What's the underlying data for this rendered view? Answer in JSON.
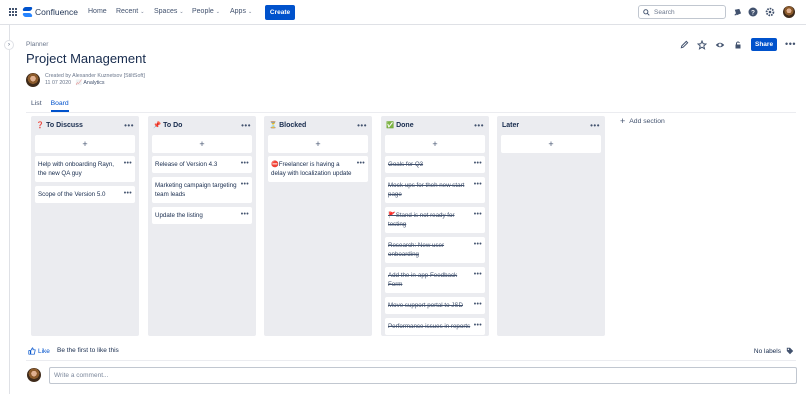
{
  "nav": {
    "product": "Confluence",
    "items": [
      {
        "label": "Home",
        "dropdown": false
      },
      {
        "label": "Recent",
        "dropdown": true
      },
      {
        "label": "Spaces",
        "dropdown": true
      },
      {
        "label": "People",
        "dropdown": true
      },
      {
        "label": "Apps",
        "dropdown": true
      }
    ],
    "create_label": "Create",
    "search_placeholder": "Search",
    "icons": [
      "notifications-icon",
      "help-icon",
      "settings-icon",
      "profile-avatar"
    ]
  },
  "page": {
    "breadcrumb": "Planner",
    "title": "Project Management",
    "author_line": "Created by Alexander Kuznetsov [StiltSoft]",
    "date": "11 07 2020",
    "analytics_label": "Analytics",
    "share_label": "Share",
    "action_icons": [
      "edit-icon",
      "star-icon",
      "watch-icon",
      "restrictions-icon",
      "more-icon"
    ]
  },
  "tabs": [
    {
      "label": "List",
      "active": false
    },
    {
      "label": "Board",
      "active": true
    }
  ],
  "board": {
    "columns": [
      {
        "emoji": "❓",
        "title": "To Discuss",
        "cards": [
          {
            "text": "Help with onboarding Rayn, the new QA guy",
            "done": false
          },
          {
            "text": "Scope of the Version 5.0",
            "done": false
          }
        ]
      },
      {
        "emoji": "📌",
        "title": "To Do",
        "cards": [
          {
            "text": "Release of Version 4.3",
            "done": false
          },
          {
            "text": "Marketing campaign targeting team leads",
            "done": false
          },
          {
            "text": "Update the listing",
            "done": false
          }
        ]
      },
      {
        "emoji": "⏳",
        "title": "Blocked",
        "cards": [
          {
            "text": "⛔Freelancer is having a delay with localization update",
            "done": false
          }
        ]
      },
      {
        "emoji": "✅",
        "title": "Done",
        "cards": [
          {
            "text": "Goals for Q3",
            "done": true
          },
          {
            "text": "Mock-ups for theh new start page",
            "done": true
          },
          {
            "text": "🚩Stand is not ready for testing",
            "done": true
          },
          {
            "text": "Research: New user onboarding",
            "done": true
          },
          {
            "text": "Add the in-app Feedback Form",
            "done": true
          },
          {
            "text": "Move support portal to JSD",
            "done": true
          },
          {
            "text": "Performance issues in reports",
            "done": true
          }
        ]
      },
      {
        "emoji": "",
        "title": "Later",
        "cards": []
      }
    ],
    "add_section_label": "Add section"
  },
  "footer": {
    "like_label": "Like",
    "like_text": "Be the first to like this",
    "labels_text": "No labels",
    "comment_placeholder": "Write a comment..."
  },
  "colors": {
    "brand": "#0052cc",
    "column_bg": "#ebecf0",
    "text": "#172b4d"
  }
}
